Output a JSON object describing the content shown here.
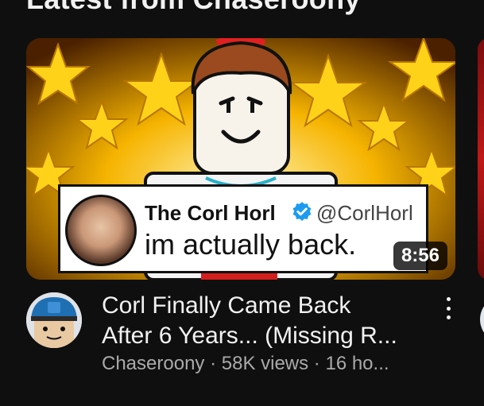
{
  "section": {
    "title": "Latest from Chaseroony"
  },
  "video": {
    "duration": "8:56",
    "title_line1": "Corl Finally Came Back",
    "title_line2": "After 6 Years... (Missing R...",
    "channel": "Chaseroony",
    "views": "58K views",
    "age": "16 ho...",
    "separator": " · ",
    "thumbnail": {
      "tweet_name": "The Corl Horl",
      "tweet_handle": "@CorlHorl",
      "tweet_text": "im actually back.",
      "verified_color": "#1d9bf0"
    }
  },
  "icons": {
    "menu": "more-vert-icon",
    "verified": "verified-badge-icon"
  },
  "colors": {
    "background": "#0f0f0f",
    "primary_text": "#f1f1f1",
    "secondary_text": "#aaaaaa"
  }
}
